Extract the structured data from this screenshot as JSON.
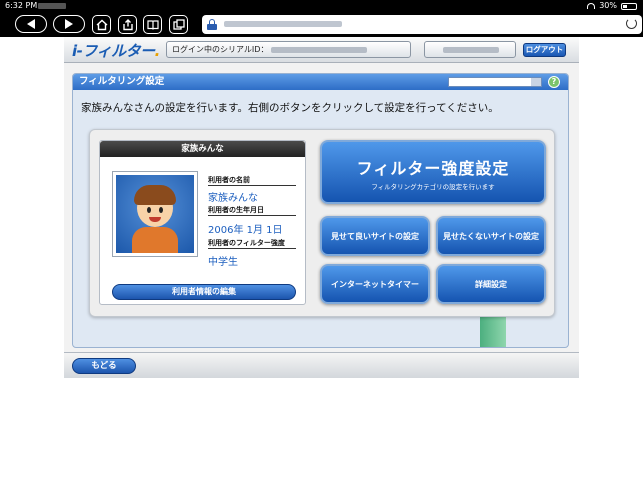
{
  "status_bar": {
    "time": "6:32 PM",
    "battery": "30%"
  },
  "toolbar": {
    "url_display": ""
  },
  "header": {
    "logo": "i-フィルター",
    "serial_label": "ログイン中のシリアルID：",
    "logout": "ログアウト"
  },
  "main": {
    "title": "フィルタリング設定",
    "help": "?",
    "instruction": "家族みんなさんの設定を行います。右側のボタンをクリックして設定を行ってください。"
  },
  "profile": {
    "header": "家族みんな",
    "name_label": "利用者の名前",
    "name_value": "家族みんな",
    "birth_label": "利用者の生年月日",
    "birth_value": "2006年 1月 1日",
    "strength_label": "利用者のフィルター強度",
    "strength_value": "中学生",
    "edit_button": "利用者情報の編集"
  },
  "buttons": {
    "filter_strength": "フィルター強度設定",
    "filter_strength_sub": "フィルタリングカテゴリの設定を行います",
    "allow_sites": "見せて良いサイトの設定",
    "block_sites": "見せたくないサイトの設定",
    "internet_timer": "インターネットタイマー",
    "advanced": "詳細設定"
  },
  "footer": {
    "back": "もどる"
  },
  "colors": {
    "accent": "#1a5cb3",
    "title_bar": "#2d6dc6",
    "value_text": "#1d5fbf"
  }
}
